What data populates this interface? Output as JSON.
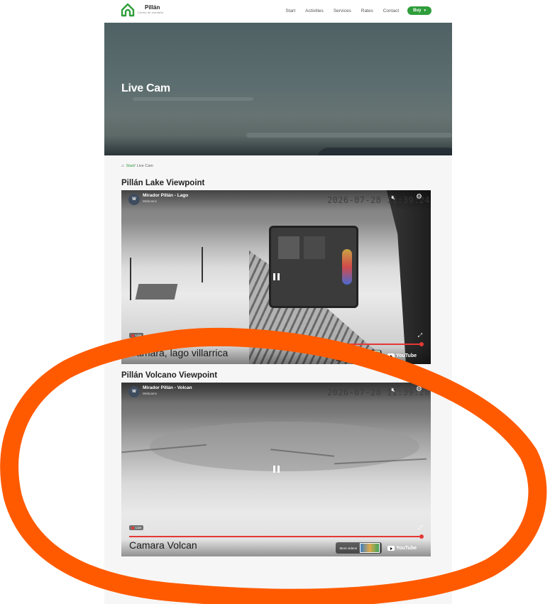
{
  "header": {
    "brand_name": "Pillán",
    "brand_tagline": "Centro de montaña",
    "nav": [
      "Start",
      "Activities",
      "Services",
      "Rates",
      "Contact"
    ],
    "buy_label": "Buy"
  },
  "hero": {
    "title": "Live Cam"
  },
  "breadcrumb": {
    "home": "Start",
    "separator": "/",
    "current": "Live Cam"
  },
  "cams": [
    {
      "section_title": "Pillán Lake Viewpoint",
      "video_title": "Mirador Pillán - Lago",
      "channel": "Webcams",
      "avatar_letter": "W",
      "timestamp": "2026-07-28 11:39:24",
      "live_label": "Live",
      "caption": "Camara, lago villarrica",
      "more_videos_label": "More videos",
      "youtube_label": "YouTube"
    },
    {
      "section_title": "Pillán Volcano Viewpoint",
      "video_title": "Mirador Pillán - Volcan",
      "channel": "Webcams",
      "avatar_letter": "W",
      "timestamp": "2026-07-28 11:39:28",
      "live_label": "Live",
      "caption": "Camara Volcan",
      "more_videos_label": "More videos",
      "youtube_label": "YouTube"
    }
  ],
  "colors": {
    "accent": "#2e9e3b",
    "annotation": "#ff5a00",
    "progress": "#e53935"
  }
}
